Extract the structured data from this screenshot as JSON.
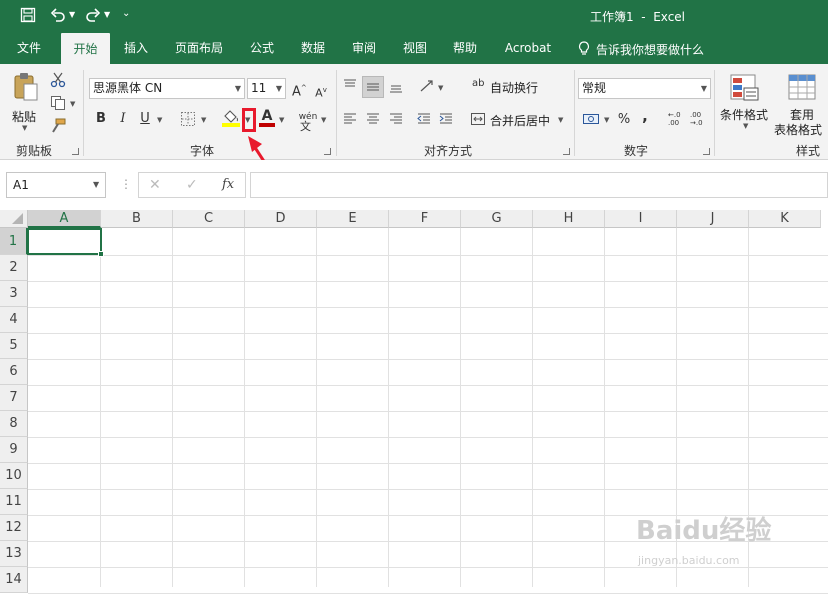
{
  "titlebar": {
    "title": "工作簿1  -  Excel",
    "save_icon": "save-icon",
    "undo_icon": "undo-icon",
    "redo_icon": "redo-icon",
    "customize_icon": "customize-qat-icon"
  },
  "tabs": [
    "文件",
    "开始",
    "插入",
    "页面布局",
    "公式",
    "数据",
    "审阅",
    "视图",
    "帮助",
    "Acrobat"
  ],
  "tell_me": "告诉我你想要做什么",
  "ribbon": {
    "clipboard": {
      "paste_label": "粘贴",
      "group_label": "剪贴板"
    },
    "font": {
      "font_name": "思源黑体 CN",
      "font_size": "11",
      "bold": "B",
      "italic": "I",
      "underline": "U",
      "grow": "A",
      "shrink": "A",
      "color_letter": "A",
      "wen": "wén",
      "group_label": "字体",
      "fill_color": "#ffff00",
      "font_color": "#c00000"
    },
    "alignment": {
      "wrap_label": "自动换行",
      "merge_label": "合并后居中",
      "group_label": "对齐方式"
    },
    "number": {
      "format": "常规",
      "percent": "%",
      "comma": ",",
      "group_label": "数字",
      "inc_dec": "←.0 .00",
      "dec_dec": ".00 →.0"
    },
    "styles": {
      "conditional_label": "条件格式",
      "table_label_1": "套用",
      "table_label_2": "表格格式",
      "group_label": "样式"
    }
  },
  "formula_bar": {
    "name_box": "A1",
    "cancel": "✕",
    "enter": "✓",
    "fx": "fx",
    "value": ""
  },
  "sheet": {
    "columns": [
      "A",
      "B",
      "C",
      "D",
      "E",
      "F",
      "G",
      "H",
      "I",
      "J",
      "K"
    ],
    "rows": [
      "1",
      "2",
      "3",
      "4",
      "5",
      "6",
      "7",
      "8",
      "9",
      "10",
      "11",
      "12",
      "13",
      "14"
    ],
    "selected_cell": "A1"
  },
  "annotation": {
    "highlight_color": "#e8192c"
  },
  "watermark": {
    "text": "Baidu经验",
    "sub": "jingyan.baidu.com"
  }
}
